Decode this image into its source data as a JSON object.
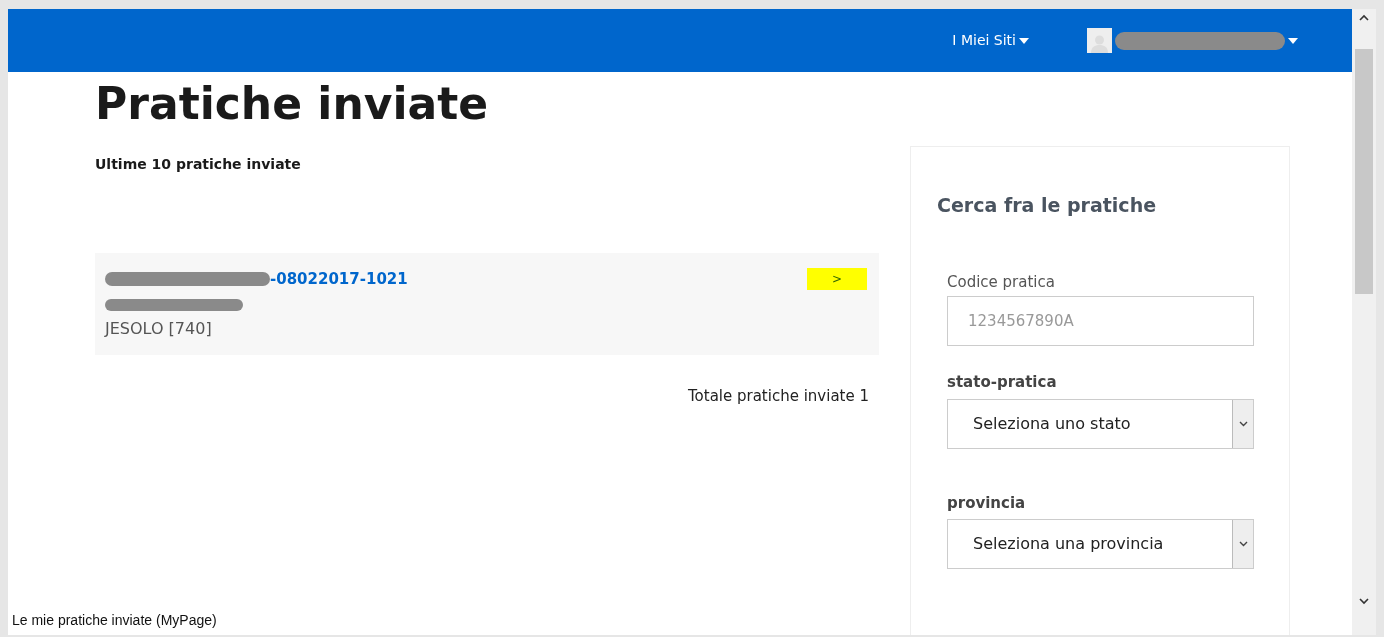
{
  "header": {
    "menu_label": "I Miei Siti"
  },
  "page": {
    "title": "Pratiche inviate",
    "subtitle": "Ultime 10 pratiche inviate"
  },
  "pratiche": [
    {
      "code": "-08022017-1021",
      "location": "JESOLO [740]",
      "open_label": ">"
    }
  ],
  "total": "Totale pratiche inviate 1",
  "search": {
    "title": "Cerca fra le pratiche",
    "code_label": "Codice pratica",
    "code_placeholder": "1234567890A",
    "state_label": "stato-pratica",
    "state_value": "Seleziona uno stato",
    "province_label": "provincia",
    "province_value": "Seleziona una provincia"
  },
  "status_bar": "Le mie pratiche inviate (MyPage)"
}
